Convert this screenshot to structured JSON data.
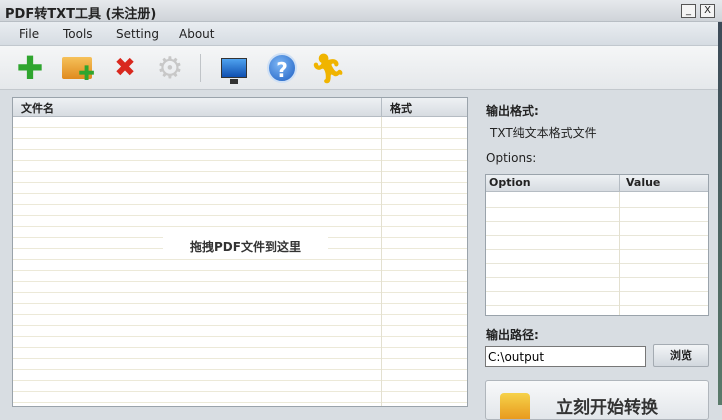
{
  "window": {
    "title": "PDF转TXT工具 (未注册)",
    "minimize": "_",
    "close": "X"
  },
  "menu": [
    "File",
    "Tools",
    "Setting",
    "About"
  ],
  "toolbar": [
    {
      "name": "add-file",
      "glyph": "✚",
      "color": "#2fa52f"
    },
    {
      "name": "add-folder",
      "glyph": "▬",
      "color": "#e89a2a"
    },
    {
      "name": "remove",
      "glyph": "✖",
      "color": "#d9281e"
    },
    {
      "name": "settings",
      "glyph": "⚙",
      "color": "#c8c8c8"
    },
    {
      "name": "monitor",
      "glyph": "▣",
      "color": "#1b6fd1"
    },
    {
      "name": "help",
      "glyph": "?",
      "color": "#2a6fd0"
    },
    {
      "name": "run",
      "glyph": "Ꮖ",
      "color": "#f0b400"
    }
  ],
  "filelist": {
    "col_name": "文件名",
    "col_format": "格式",
    "drop_hint": "拖拽PDF文件到这里"
  },
  "right": {
    "output_format_label": "输出格式:",
    "output_format_value": "TXT纯文本格式文件",
    "options_label": "Options:",
    "col_option": "Option",
    "col_value": "Value",
    "output_path_label": "输出路径:",
    "output_path_value": "C:\\output",
    "browse": "浏览",
    "start": "立刻开始转换"
  }
}
